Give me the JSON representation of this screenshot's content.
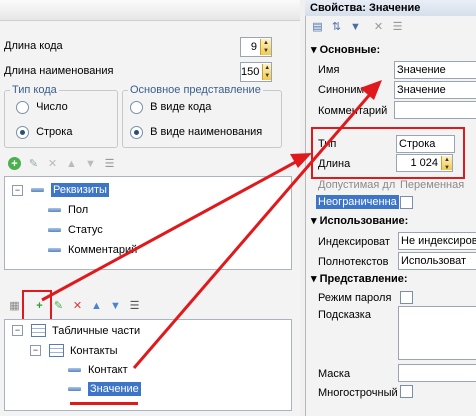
{
  "left": {
    "code_length": {
      "label": "Длина кода",
      "value": "9"
    },
    "name_length": {
      "label": "Длина наименования",
      "value": "150"
    },
    "code_type": {
      "title": "Тип кода",
      "options": [
        "Число",
        "Строка"
      ],
      "selected": 1
    },
    "main_repr": {
      "title": "Основное представление",
      "options": [
        "В виде кода",
        "В виде наименования"
      ],
      "selected": 1
    },
    "attributes_tree": {
      "root": "Реквизиты",
      "items": [
        "Пол",
        "Статус",
        "Комментарий"
      ]
    },
    "tabular_tree": {
      "root": "Табличные части",
      "part": "Контакты",
      "items": [
        "Контакт",
        "Значение"
      ]
    }
  },
  "right": {
    "title": "Свойства: Значение",
    "sections": {
      "basic": "Основные:",
      "usage": "Использование:",
      "presentation": "Представление:"
    },
    "name": {
      "label": "Имя",
      "value": "Значение"
    },
    "synonym": {
      "label": "Синоним",
      "value": "Значение"
    },
    "comment": {
      "label": "Комментарий",
      "value": ""
    },
    "type": {
      "label": "Тип",
      "value": "Строка"
    },
    "length": {
      "label": "Длина",
      "value": "1 024"
    },
    "allowed_length": {
      "label": "Допустимая дл",
      "value": "Переменная"
    },
    "unlimited": {
      "label": "Неограниченна"
    },
    "indexing": {
      "label": "Индексироват",
      "value": "Не индексиров"
    },
    "fulltext": {
      "label": "Полнотекстов",
      "value": "Использоват"
    },
    "password_mode": {
      "label": "Режим пароля"
    },
    "hint": {
      "label": "Подсказка"
    },
    "mask": {
      "label": "Маска"
    },
    "multiline": {
      "label": "Многострочный"
    }
  },
  "colors": {
    "accent_red": "#e0191d",
    "selection": "#3d76c8"
  }
}
